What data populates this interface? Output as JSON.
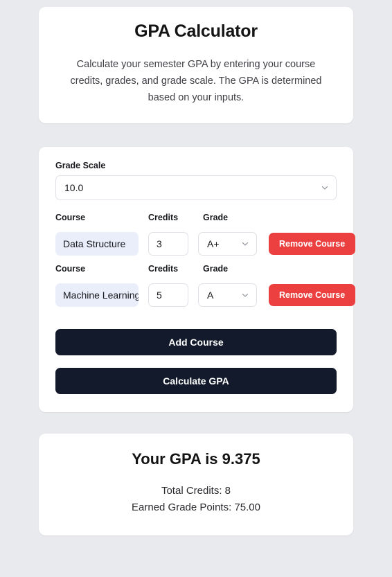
{
  "header": {
    "title": "GPA Calculator",
    "description": "Calculate your semester GPA by entering your course credits, grades, and grade scale. The GPA is determined based on your inputs."
  },
  "form": {
    "grade_scale_label": "Grade Scale",
    "grade_scale_value": "10.0",
    "column_labels": {
      "course": "Course",
      "credits": "Credits",
      "grade": "Grade"
    },
    "remove_label": "Remove Course",
    "courses": [
      {
        "name": "Data Structure",
        "credits": "3",
        "grade": "A+"
      },
      {
        "name": "Machine Learning",
        "credits": "5",
        "grade": "A"
      }
    ],
    "add_course_label": "Add Course",
    "calculate_label": "Calculate GPA"
  },
  "result": {
    "gpa_text": "Your GPA is 9.375",
    "total_credits_text": "Total Credits: 8",
    "earned_points_text": "Earned Grade Points: 75.00"
  },
  "colors": {
    "page_background": "#e9eaed",
    "card": "#ffffff",
    "dark_button": "#121a2b",
    "danger": "#ec4040",
    "input_highlight": "#e9eefa"
  }
}
